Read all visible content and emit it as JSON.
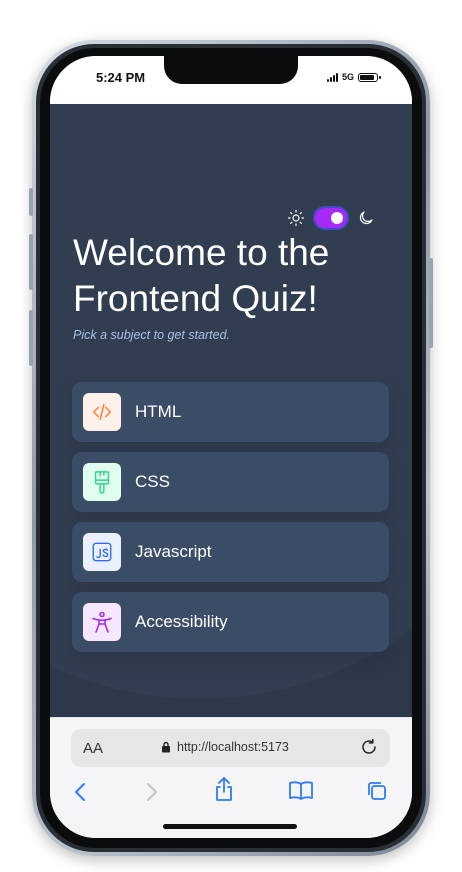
{
  "status_bar": {
    "time": "5:24 PM",
    "network": "5G",
    "battery_level": 0.9
  },
  "app": {
    "title": "Welcome to the Frontend Quiz!",
    "subtitle": "Pick a subject to get started.",
    "theme": {
      "dark_mode_on": true
    },
    "subjects": [
      {
        "label": "HTML",
        "icon": "code-brackets-icon",
        "icon_bg": "#fff1e9",
        "icon_color": "#ff7e35"
      },
      {
        "label": "CSS",
        "icon": "paintbrush-icon",
        "icon_bg": "#e0fdef",
        "icon_color": "#2fd887"
      },
      {
        "label": "Javascript",
        "icon": "js-icon",
        "icon_bg": "#ebf0ff",
        "icon_color": "#306aff"
      },
      {
        "label": "Accessibility",
        "icon": "accessibility-person-icon",
        "icon_bg": "#f6e7ff",
        "icon_color": "#a729f5"
      }
    ],
    "colors": {
      "background": "#313e51",
      "card": "#3b4d66",
      "accent": "#a729f5",
      "subtitle": "#abc1e1"
    }
  },
  "browser": {
    "aa_label": "AA",
    "url": "http://localhost:5173"
  }
}
